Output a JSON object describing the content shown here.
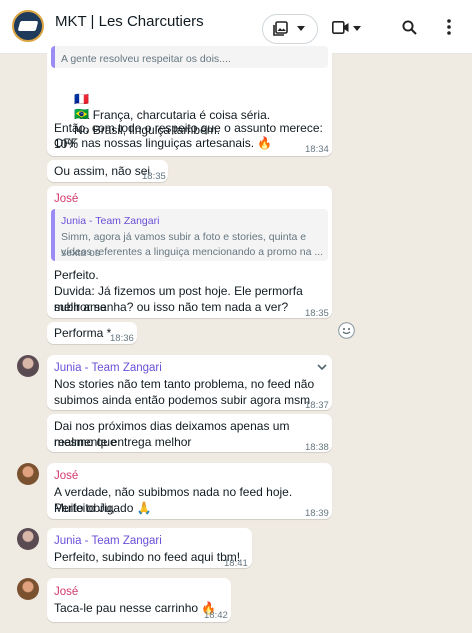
{
  "header": {
    "title": "MKT | Les Charcutiers"
  },
  "messages": {
    "m1": {
      "quote_text": "A gente resolveu respeitar os dois....",
      "line1_flag": "🇫🇷",
      "line1": "Na França, charcutaria é coisa séria.",
      "line2_flag": "🇧🇷",
      "line2": "No Brasil, linguiça também.",
      "line3": "Então, com todo o respeito que o assunto merece: 10%",
      "line4": "OFF nas nossas linguiças artesanais. 🔥",
      "time": "18:34"
    },
    "m2": {
      "text": "Ou assim, não sei",
      "time": "18:35"
    },
    "m3": {
      "sender": "José",
      "quote_sender": "Junia - Team Zangari",
      "quote_line1": "Simm, agora já vamos subir a foto e stories, quinta e sexta os",
      "quote_line2": "vídeos referentes a linguiça mencionando a promo na ...",
      "line1": "Perfeito.",
      "line2": "Duvida: Já fizemos um post hoje. Ele permorfa melhor se",
      "line3": "subir amanha? ou isso não tem nada a ver?",
      "time": "18:35"
    },
    "m4": {
      "text": "Performa *",
      "time": "18:36"
    },
    "m5": {
      "sender": "Junia - Team Zangari",
      "line1": "Nos stories não tem tanto problema, no feed não",
      "line2": "subimos ainda então podemos subir agora msm",
      "time": "18:37"
    },
    "m6": {
      "line1": "Dai nos próximos dias deixamos apenas um mesmo que",
      "line2": "realmente entrega melhor",
      "time": "18:38"
    },
    "m7": {
      "sender": "José",
      "line1": "A verdade, não subibmos nada no feed hoje. Perfeito Ju,",
      "line2": "Muito obrigado 🙏",
      "time": "18:39"
    },
    "m8": {
      "sender": "Junia - Team Zangari",
      "text": "Perfeito, subindo no feed aqui tbm!",
      "time": "18:41"
    },
    "m9": {
      "sender": "José",
      "text": "Taca-le pau nesse carrinho 🔥",
      "time": "18:42"
    }
  },
  "colors": {
    "jose": "#d3396d",
    "junia": "#6b4fd8",
    "wallpaper": "#efeae2",
    "bubble": "#ffffff"
  },
  "icons": [
    "group-avatar",
    "photo-album-icon",
    "chevron-down-icon",
    "video-camera-icon",
    "search-icon",
    "kebab-menu-icon",
    "emoji-react-icon"
  ]
}
